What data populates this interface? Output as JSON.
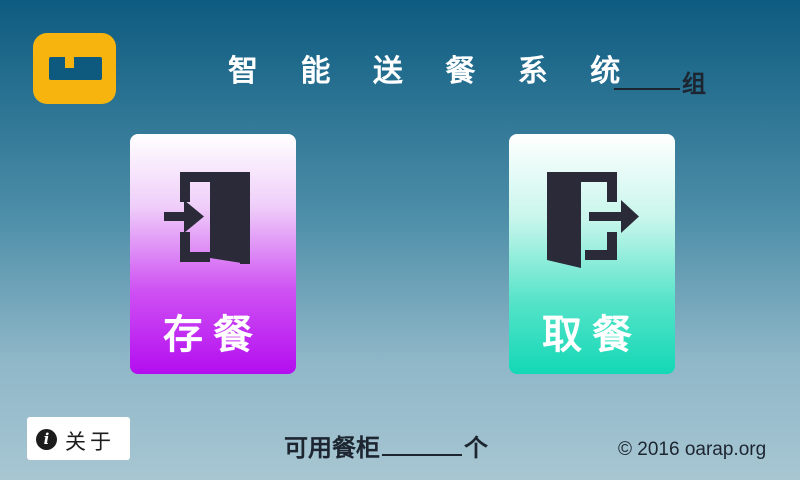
{
  "header": {
    "logo_icon": "app-logo-icon",
    "logo_color": "#f7b40e",
    "title": "智 能 送 餐 系 统",
    "group_value": "",
    "group_suffix": "组"
  },
  "actions": {
    "store": {
      "label": "存餐",
      "icon": "door-enter-icon",
      "accent": "#b40df0"
    },
    "take": {
      "label": "取餐",
      "icon": "door-exit-icon",
      "accent": "#13d8b5"
    }
  },
  "footer": {
    "about_icon": "info-icon",
    "about_icon_glyph": "i",
    "about_label": "关于",
    "available_prefix": "可用餐柜",
    "available_count": "",
    "available_suffix": "个",
    "copyright": "© 2016 oarap.org"
  }
}
